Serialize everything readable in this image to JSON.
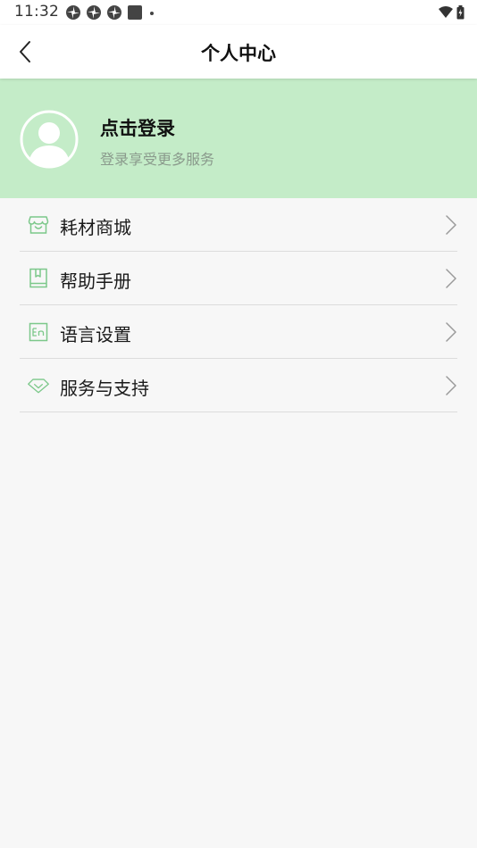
{
  "status_bar": {
    "time": "11:32"
  },
  "header": {
    "title": "个人中心"
  },
  "profile": {
    "login_text": "点击登录",
    "subtitle": "登录享受更多服务"
  },
  "menu": {
    "items": [
      {
        "label": "耗材商城",
        "icon": "store-icon"
      },
      {
        "label": "帮助手册",
        "icon": "book-icon"
      },
      {
        "label": "语言设置",
        "icon": "language-icon"
      },
      {
        "label": "服务与支持",
        "icon": "diamond-icon"
      }
    ]
  },
  "colors": {
    "accent": "#7cc88a",
    "profile_bg": "#c4ecc8",
    "page_bg": "#f7f7f7"
  }
}
